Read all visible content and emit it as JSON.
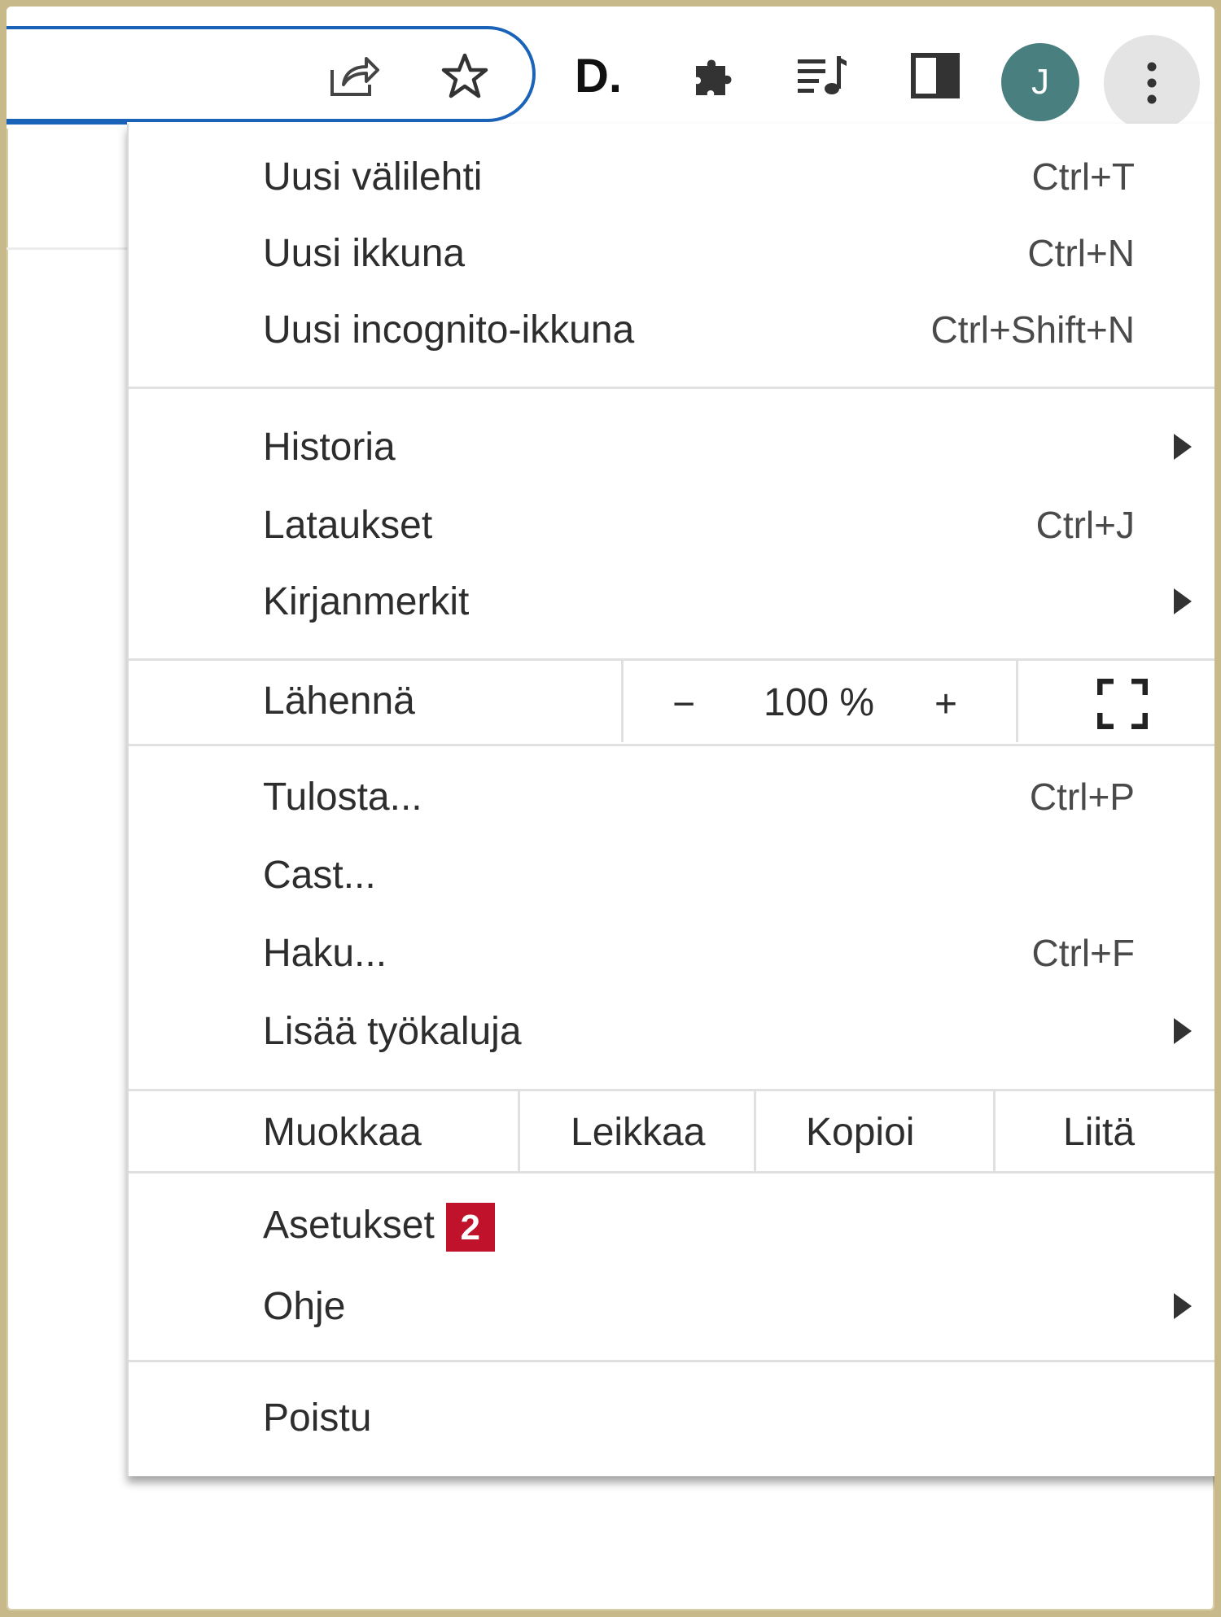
{
  "toolbar": {
    "share_icon": "share-icon",
    "bookmark_icon": "star-icon",
    "extension_d_label": "D.",
    "extensions_icon": "puzzle-icon",
    "media_icon": "playlist-music-icon",
    "side_panel_icon": "side-panel-icon",
    "avatar_initial": "J",
    "menu_icon": "vertical-dots-icon",
    "accent_color": "#1a63b8"
  },
  "menu": {
    "new_tab": {
      "label": "Uusi välilehti",
      "shortcut": "Ctrl+T"
    },
    "new_window": {
      "label": "Uusi ikkuna",
      "shortcut": "Ctrl+N"
    },
    "incognito": {
      "label": "Uusi incognito-ikkuna",
      "shortcut": "Ctrl+Shift+N"
    },
    "history": {
      "label": "Historia"
    },
    "downloads": {
      "label": "Lataukset",
      "shortcut": "Ctrl+J"
    },
    "bookmarks": {
      "label": "Kirjanmerkit"
    },
    "zoom": {
      "label": "Lähennä",
      "minus": "−",
      "value": "100 %",
      "plus": "+"
    },
    "print": {
      "label": "Tulosta...",
      "shortcut": "Ctrl+P"
    },
    "cast": {
      "label": "Cast..."
    },
    "find": {
      "label": "Haku...",
      "shortcut": "Ctrl+F"
    },
    "more_tools": {
      "label": "Lisää työkaluja"
    },
    "edit": {
      "label": "Muokkaa",
      "cut": "Leikkaa",
      "copy": "Kopioi",
      "paste": "Liitä"
    },
    "settings": {
      "label": "Asetukset",
      "badge": "2",
      "badge_color": "#c0122b"
    },
    "help": {
      "label": "Ohje"
    },
    "exit": {
      "label": "Poistu"
    }
  }
}
